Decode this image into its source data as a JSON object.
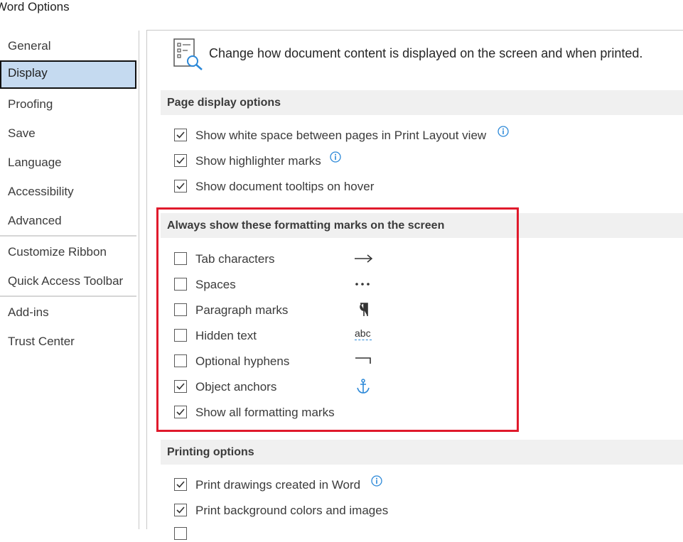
{
  "window": {
    "title": "Word Options"
  },
  "sidebar": {
    "items": [
      {
        "label": "General"
      },
      {
        "label": "Display",
        "selected": true
      },
      {
        "label": "Proofing"
      },
      {
        "label": "Save"
      },
      {
        "label": "Language"
      },
      {
        "label": "Accessibility"
      },
      {
        "label": "Advanced"
      },
      {
        "label": "Customize Ribbon"
      },
      {
        "label": "Quick Access Toolbar"
      },
      {
        "label": "Add-ins"
      },
      {
        "label": "Trust Center"
      }
    ]
  },
  "header": {
    "icon": "display-settings-icon",
    "text": "Change how document content is displayed on the screen and when printed."
  },
  "page_display": {
    "title": "Page display options",
    "options": [
      {
        "label": "Show white space between pages in Print Layout view",
        "checked": true,
        "info": true
      },
      {
        "label": "Show highlighter marks",
        "checked": true,
        "info": true
      },
      {
        "label": "Show document tooltips on hover",
        "checked": true
      }
    ]
  },
  "formatting_marks": {
    "title": "Always show these formatting marks on the screen",
    "options": [
      {
        "label": "Tab characters",
        "checked": false,
        "mark": "arrow-icon"
      },
      {
        "label": "Spaces",
        "checked": false,
        "mark": "dots-icon"
      },
      {
        "label": "Paragraph marks",
        "checked": false,
        "mark": "pilcrow-icon"
      },
      {
        "label": "Hidden text",
        "checked": false,
        "mark": "hidden-text-icon",
        "mark_text": "abc"
      },
      {
        "label": "Optional hyphens",
        "checked": false,
        "mark": "optional-hyphen-icon"
      },
      {
        "label": "Object anchors",
        "checked": true,
        "mark": "anchor-icon"
      },
      {
        "label": "Show all formatting marks",
        "checked": true
      }
    ],
    "highlight_color": "#e01a2c"
  },
  "printing": {
    "title": "Printing options",
    "options": [
      {
        "label": "Print drawings created in Word",
        "checked": true,
        "info": true
      },
      {
        "label": "Print background colors and images",
        "checked": true
      }
    ]
  },
  "colors": {
    "selected_bg": "#c5daf0",
    "section_bg": "#f0f0f0",
    "accent": "#2b88d8"
  }
}
